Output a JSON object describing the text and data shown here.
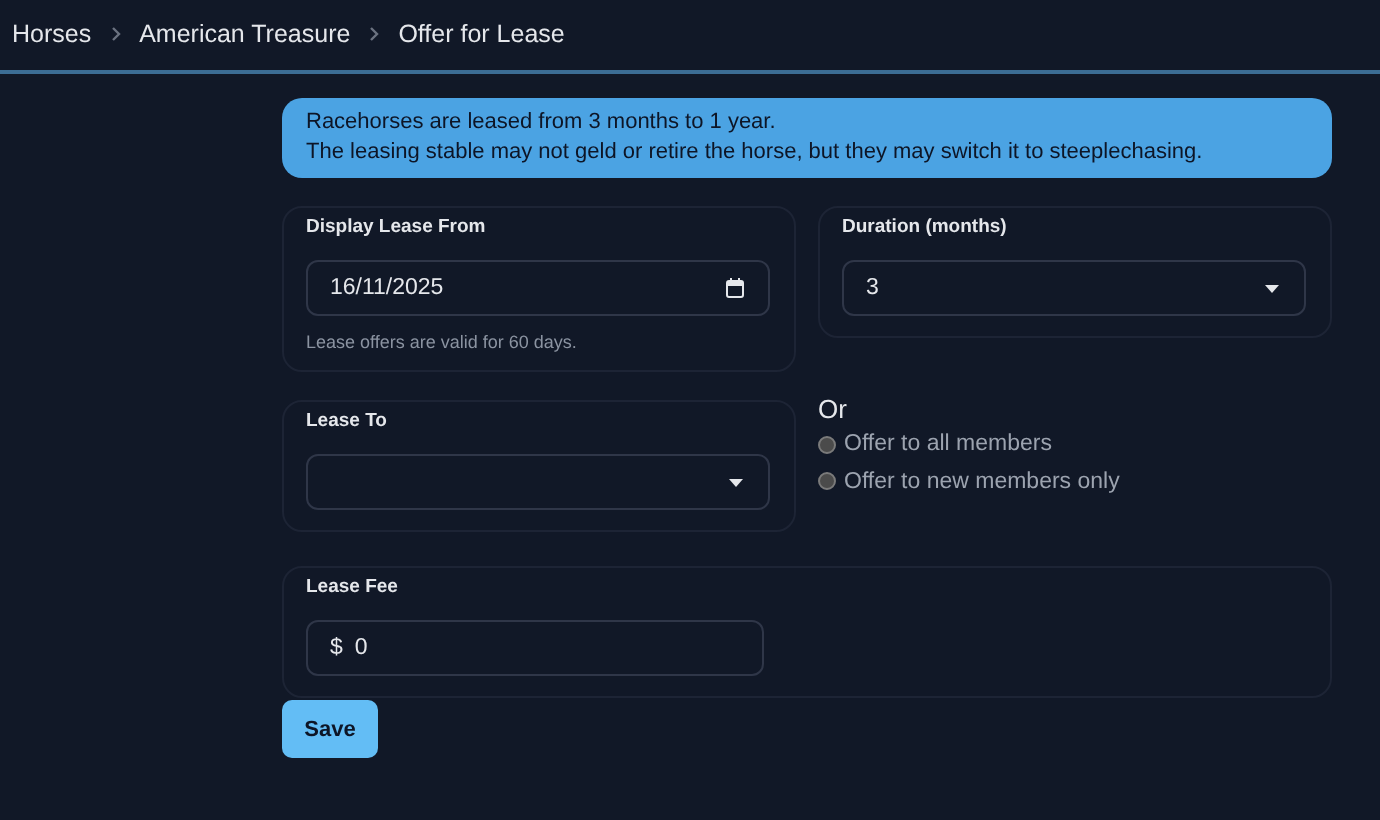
{
  "breadcrumb": [
    {
      "label": "Horses"
    },
    {
      "label": "American Treasure"
    },
    {
      "label": "Offer for Lease"
    }
  ],
  "notice": {
    "lines": [
      "Racehorses are leased from 3 months to 1 year.",
      "The leasing stable may not geld or retire the horse, but they may switch it to steeplechasing."
    ]
  },
  "lease_from": {
    "label": "Display Lease From",
    "value": "16/11/2025",
    "helper": "Lease offers are valid for 60 days."
  },
  "duration": {
    "label": "Duration (months)",
    "value": "3"
  },
  "lease_to": {
    "label": "Lease To"
  },
  "audience": {
    "heading": "Or",
    "options": [
      {
        "label": "Offer to all members",
        "selected": false
      },
      {
        "label": "Offer to new members only",
        "selected": false
      }
    ]
  },
  "lease_fee": {
    "label": "Lease Fee",
    "prefix": "$",
    "value": "0"
  },
  "save_button": {
    "label": "Save"
  }
}
